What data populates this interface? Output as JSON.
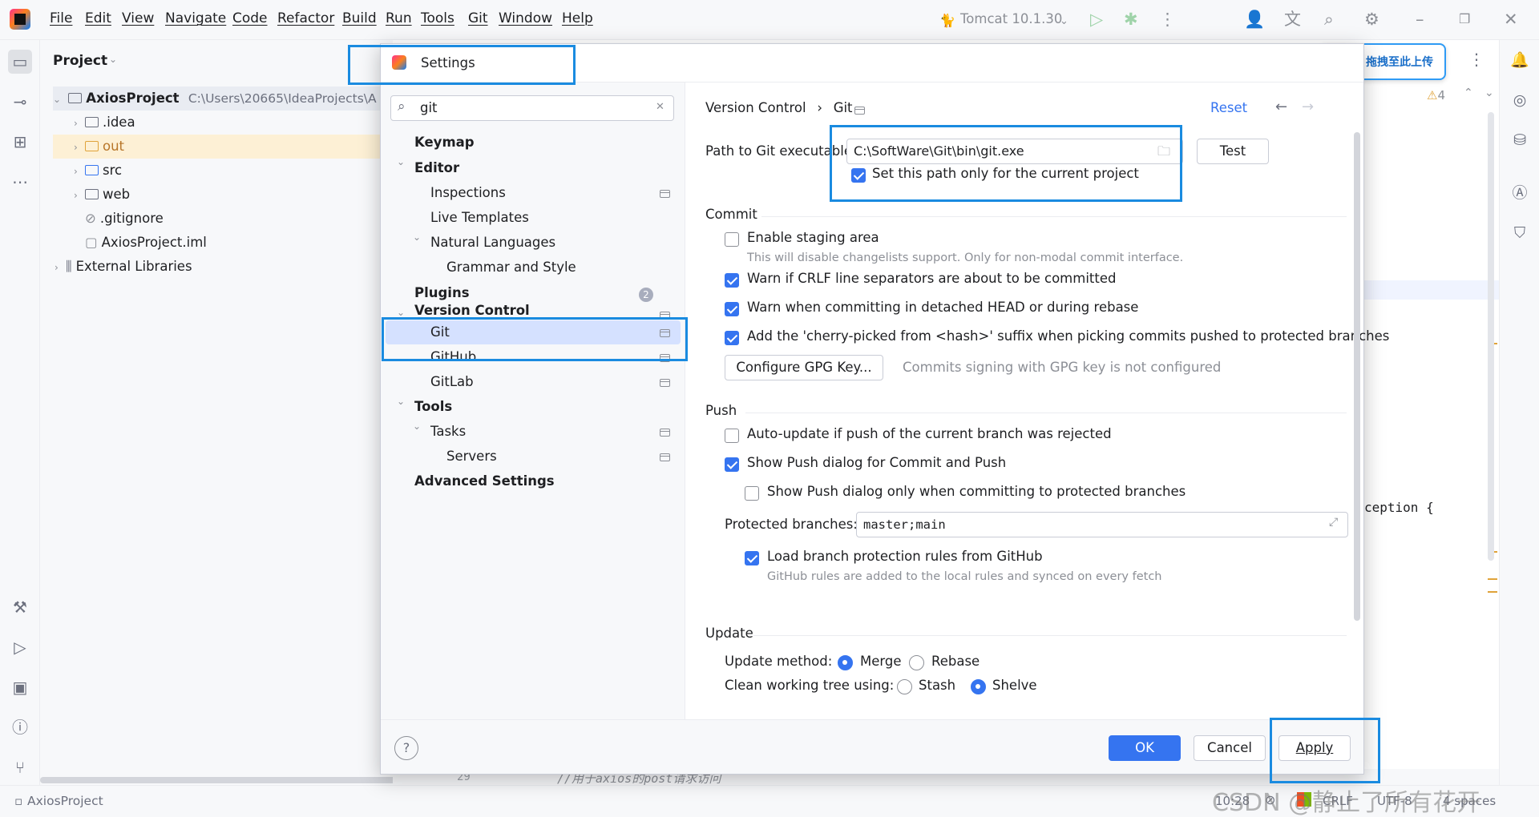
{
  "menu": [
    "File",
    "Edit",
    "View",
    "Navigate",
    "Code",
    "Refactor",
    "Build",
    "Run",
    "Tools",
    "Git",
    "Window",
    "Help"
  ],
  "toolbar": {
    "run_config": "Tomcat 10.1.30"
  },
  "project": {
    "header": "Project",
    "root": "AxiosProject",
    "root_path": "C:\\Users\\20665\\IdeaProjects\\A",
    "items": [
      ".idea",
      "out",
      "src",
      "web",
      ".gitignore",
      "AxiosProject.iml",
      "External Libraries"
    ]
  },
  "upload_widget": {
    "label": "拖拽至此上传"
  },
  "editor": {
    "warnings": "4",
    "code_fragment": "ception {",
    "line_number": "29",
    "comment": "//用于axios的post请求访问"
  },
  "dialog": {
    "title": "Settings",
    "search_value": "git",
    "tree": {
      "keymap": "Keymap",
      "editor": "Editor",
      "inspections": "Inspections",
      "live_templates": "Live Templates",
      "natural_languages": "Natural Languages",
      "grammar_style": "Grammar and Style",
      "plugins": "Plugins",
      "plugins_badge": "2",
      "version_control": "Version Control",
      "git": "Git",
      "github": "GitHub",
      "gitlab": "GitLab",
      "tools": "Tools",
      "tasks": "Tasks",
      "servers": "Servers",
      "advanced": "Advanced Settings"
    },
    "breadcrumb": {
      "parent": "Version Control",
      "sep": "›",
      "current": "Git"
    },
    "reset": "Reset",
    "path_label": "Path to Git executable:",
    "path_value": "C:\\SoftWare\\Git\\bin\\git.exe",
    "test_button": "Test",
    "current_project_only": "Set this path only for the current project",
    "commit": {
      "title": "Commit",
      "staging": "Enable staging area",
      "staging_hint": "This will disable changelists support. Only for non-modal commit interface.",
      "crlf": "Warn if CRLF line separators are about to be committed",
      "detached": "Warn when committing in detached HEAD or during rebase",
      "cherry": "Add the 'cherry-picked from <hash>' suffix when picking commits pushed to protected branches",
      "gpg_button": "Configure GPG Key...",
      "gpg_hint": "Commits signing with GPG key is not configured"
    },
    "push": {
      "title": "Push",
      "auto_update": "Auto-update if push of the current branch was rejected",
      "show_dialog": "Show Push dialog for Commit and Push",
      "show_protected": "Show Push dialog only when committing to protected branches",
      "protected_label": "Protected branches:",
      "protected_value": "master;main",
      "load_rules": "Load branch protection rules from GitHub",
      "load_hint": "GitHub rules are added to the local rules and synced on every fetch"
    },
    "update": {
      "title": "Update",
      "method_label": "Update method:",
      "merge": "Merge",
      "rebase": "Rebase",
      "clean_label": "Clean working tree using:",
      "stash": "Stash",
      "shelve": "Shelve"
    },
    "buttons": {
      "ok": "OK",
      "cancel": "Cancel",
      "apply": "Apply"
    }
  },
  "statusbar": {
    "project": "AxiosProject",
    "position": "10:28",
    "line_sep": "CRLF",
    "encoding": "UTF-8",
    "indent": "4 spaces",
    "watermark": "CSDN @静止了所有花开"
  },
  "colors": {
    "accent": "#3574f0",
    "highlight_box": "#1a8be0",
    "selection": "#d5e1ff"
  }
}
